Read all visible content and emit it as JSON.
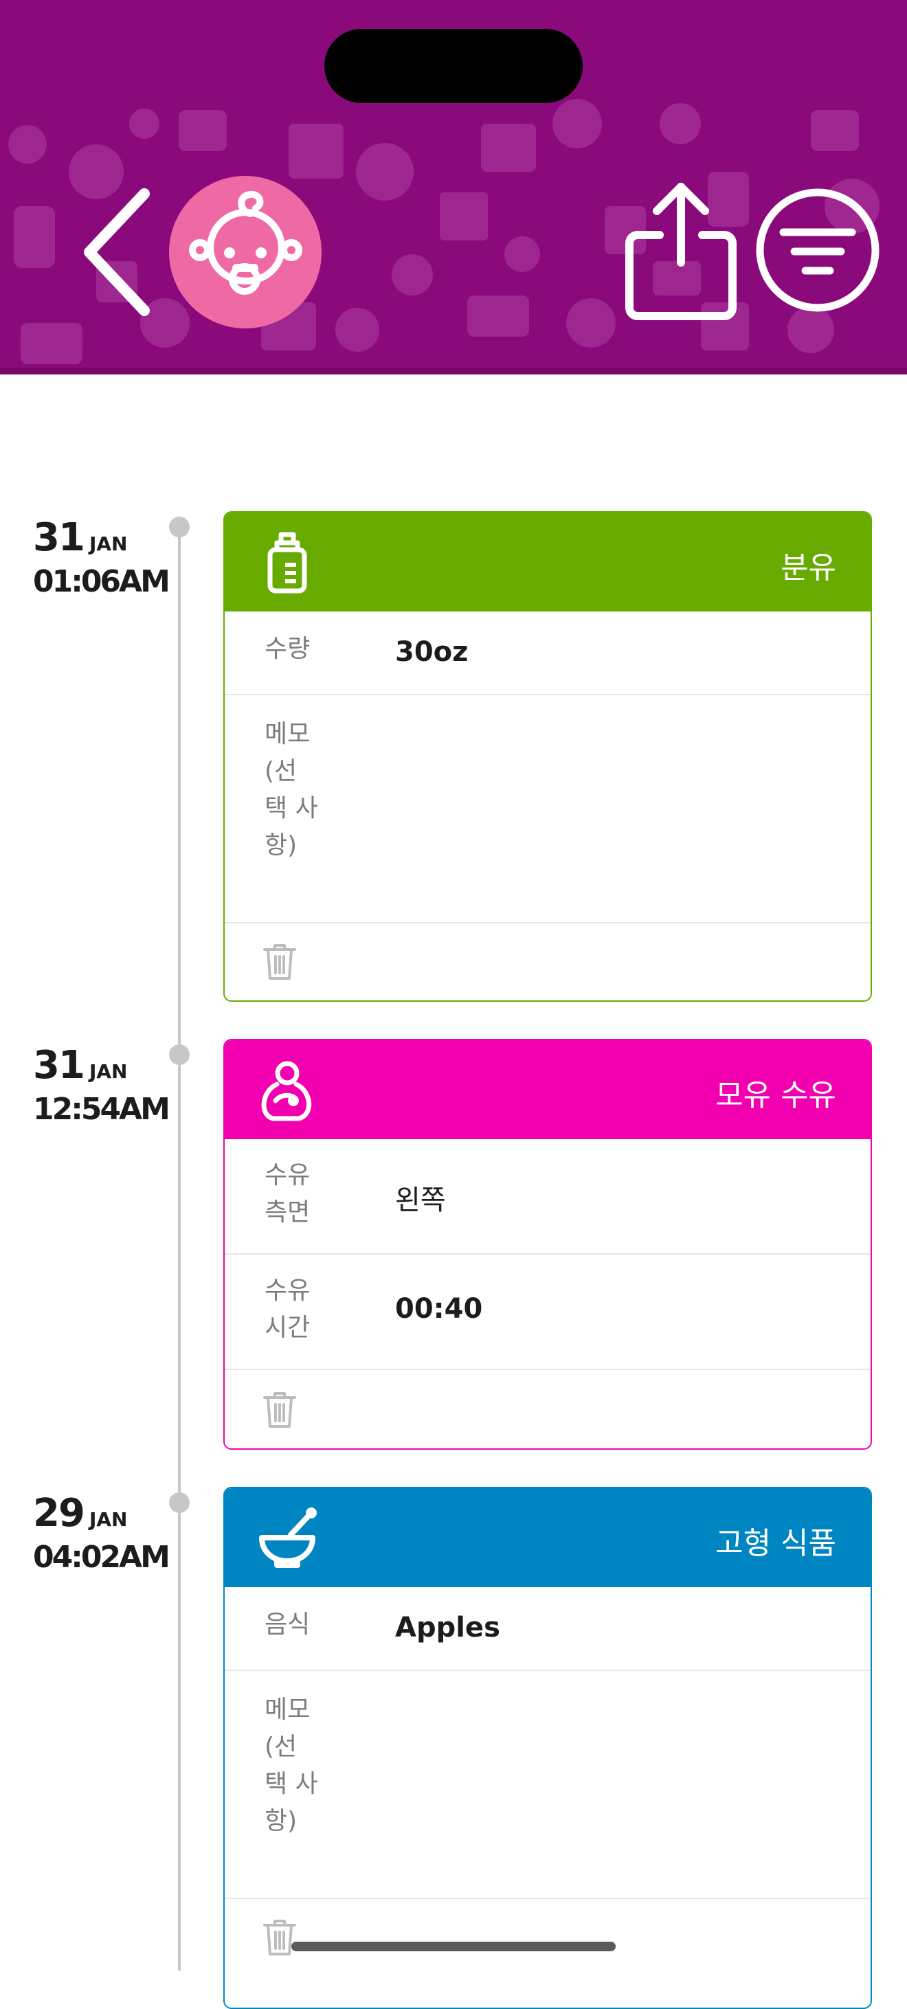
{
  "colors": {
    "header_bg": "#8a0a7c",
    "avatar_bg": "#ef6aa4",
    "formula": "#68ab00",
    "breastfeed": "#f200b0",
    "solid_food": "#0085c3",
    "timeline": "#c7c7c7"
  },
  "header": {
    "icons": [
      "back-chevron-icon",
      "baby-face-icon",
      "share-icon",
      "filter-icon"
    ]
  },
  "entries": [
    {
      "date": {
        "day": "31",
        "month": "JAN",
        "time": "01:06AM"
      },
      "type": "분유",
      "icon": "bottle-icon",
      "fields": [
        {
          "label": "수량",
          "value": "30oz"
        },
        {
          "label": "메모 (선 택 사 항)",
          "value": ""
        }
      ]
    },
    {
      "date": {
        "day": "31",
        "month": "JAN",
        "time": "12:54AM"
      },
      "type": "모유 수유",
      "icon": "breastfeeding-icon",
      "fields": [
        {
          "label": "수유 측면",
          "value": "왼쪽"
        },
        {
          "label": "수유 시간",
          "value": "00:40"
        }
      ]
    },
    {
      "date": {
        "day": "29",
        "month": "JAN",
        "time": "04:02AM"
      },
      "type": "고형 식품",
      "icon": "mortar-pestle-icon",
      "fields": [
        {
          "label": "음식",
          "value": "Apples"
        },
        {
          "label": "메모 (선 택 사 항)",
          "value": ""
        }
      ]
    }
  ]
}
